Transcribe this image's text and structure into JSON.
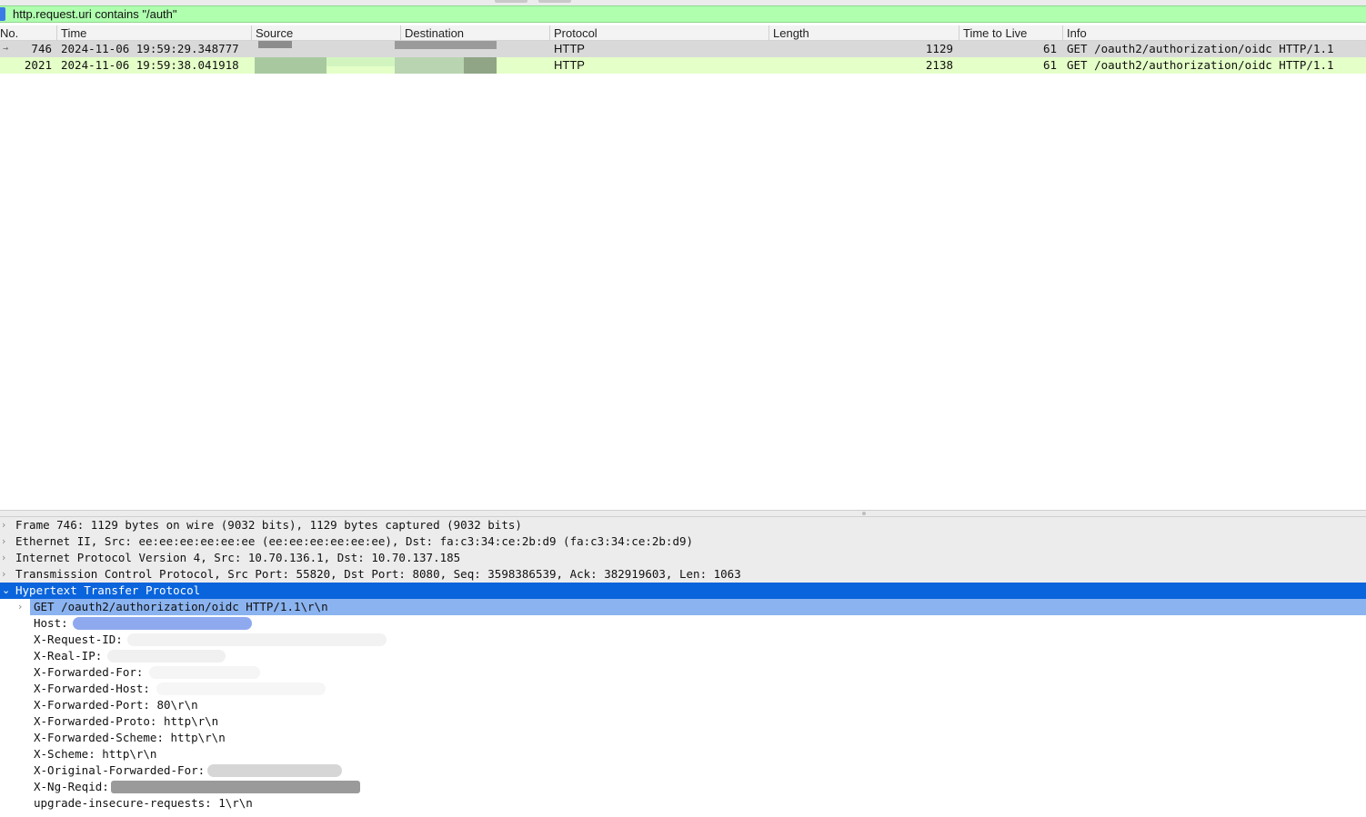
{
  "filter": {
    "expression": "http.request.uri contains \"/auth\""
  },
  "columns": [
    "No.",
    "Time",
    "Source",
    "Destination",
    "Protocol",
    "Length",
    "Time to Live",
    "Info"
  ],
  "packets": [
    {
      "no": "746",
      "time": "2024-11-06 19:59:29.348777",
      "protocol": "HTTP",
      "length": "1129",
      "ttl": "61",
      "info": "GET /oauth2/authorization/oidc HTTP/1.1"
    },
    {
      "no": "2021",
      "time": "2024-11-06 19:59:38.041918",
      "protocol": "HTTP",
      "length": "2138",
      "ttl": "61",
      "info": "GET /oauth2/authorization/oidc HTTP/1.1"
    }
  ],
  "details": {
    "frame": "Frame 746: 1129 bytes on wire (9032 bits), 1129 bytes captured (9032 bits)",
    "ethernet": "Ethernet II, Src: ee:ee:ee:ee:ee:ee (ee:ee:ee:ee:ee:ee), Dst: fa:c3:34:ce:2b:d9 (fa:c3:34:ce:2b:d9)",
    "ip": "Internet Protocol Version 4, Src: 10.70.136.1, Dst: 10.70.137.185",
    "tcp": "Transmission Control Protocol, Src Port: 55820, Dst Port: 8080, Seq: 3598386539, Ack: 382919603, Len: 1063",
    "http": "Hypertext Transfer Protocol",
    "http_fields": {
      "request_line": "GET /oauth2/authorization/oidc HTTP/1.1\\r\\n",
      "host": "Host:",
      "x_request_id": "X-Request-ID:",
      "x_real_ip": "X-Real-IP:",
      "x_forwarded_for": "X-Forwarded-For:",
      "x_forwarded_host": "X-Forwarded-Host:",
      "x_forwarded_port": "X-Forwarded-Port: 80\\r\\n",
      "x_forwarded_proto": "X-Forwarded-Proto: http\\r\\n",
      "x_forwarded_scheme": "X-Forwarded-Scheme: http\\r\\n",
      "x_scheme": "X-Scheme: http\\r\\n",
      "x_original_forwarded_for": "X-Original-Forwarded-For:",
      "x_ng_reqid": "X-Ng-Reqid:",
      "upgrade_insecure_requests": "upgrade-insecure-requests: 1\\r\\n"
    }
  },
  "colors": {
    "filter_valid": "#afffaf",
    "selected_row": "#0a64dc",
    "selected_child": "#8ab3f0",
    "http_row": "#e4ffc7"
  }
}
